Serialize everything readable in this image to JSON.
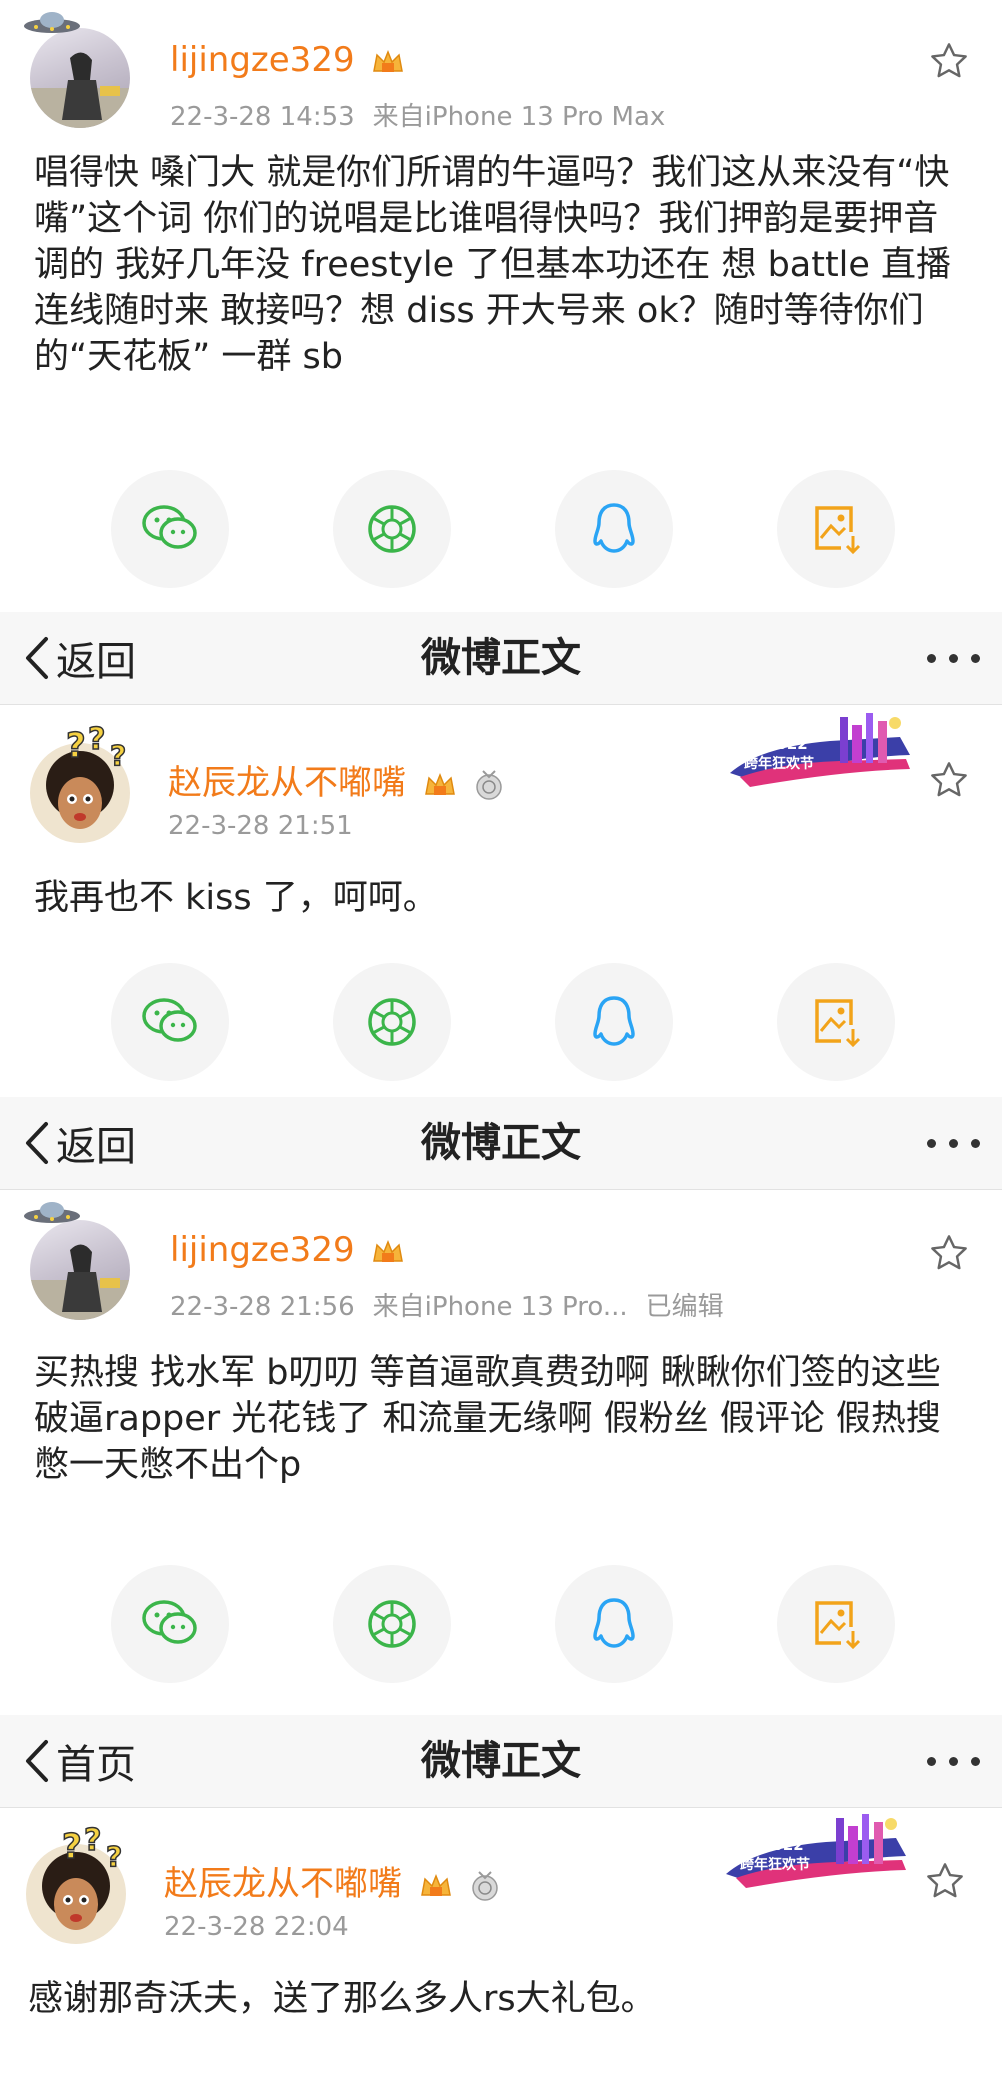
{
  "posts": [
    {
      "username": "lijingze329",
      "time": "22-3-28 14:53",
      "source": "来自iPhone 13 Pro Max",
      "edited": "",
      "content": "唱得快 嗓门大 就是你们所谓的牛逼吗？我们这从来没有“快嘴”这个词 你们的说唱是比谁唱得快吗？我们押韵是要押音调的 我好几年没 freestyle 了但基本功还在 想 battle 直播连线随时来 敢接吗？想 diss 开大号来 ok？随时等待你们的“天花板” 一群 sb"
    },
    {
      "username": "赵辰龙从不嘟嘴",
      "time": "22-3-28 21:51",
      "source": "",
      "edited": "",
      "badge_year": "2022",
      "badge_text": "跨年狂欢节",
      "content": "我再也不 kiss 了，呵呵。"
    },
    {
      "username": "lijingze329",
      "time": "22-3-28 21:56",
      "source": "来自iPhone 13 Pro...",
      "edited": "已编辑",
      "content": "买热搜 找水军 b叨叨 等首逼歌真费劲啊 瞅瞅你们签的这些破逼rapper 光花钱了 和流量无缘啊 假粉丝 假评论 假热搜 憋一天憋不出个p"
    },
    {
      "username": "赵辰龙从不嘟嘴",
      "time": "22-3-28 22:04",
      "source": "",
      "edited": "",
      "badge_year": "2022",
      "badge_text": "跨年狂欢节",
      "content": "感谢那奇沃夫，送了那么多人rs大礼包。"
    }
  ],
  "navbars": [
    {
      "back_label": "返回",
      "title": "微博正文"
    },
    {
      "back_label": "返回",
      "title": "微博正文"
    },
    {
      "back_label": "首页",
      "title": "微博正文"
    }
  ],
  "share_icons": [
    "wechat-icon",
    "moments-icon",
    "qq-icon",
    "save-image-icon"
  ],
  "colors": {
    "username": "#f27b1a",
    "meta": "#9a9a9a",
    "wechat": "#3bb54a",
    "qq": "#2aa4f4",
    "save": "#f2a31a",
    "navbar_bg": "#f7f7f7"
  }
}
